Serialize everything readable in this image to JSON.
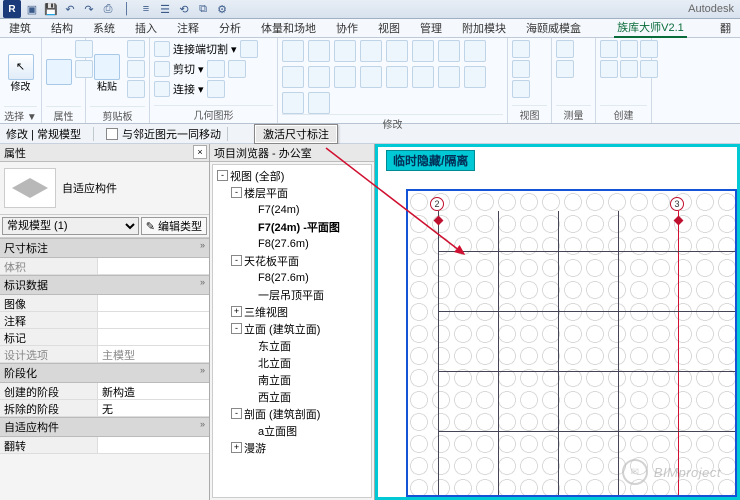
{
  "brand": "Autodesk",
  "logo": "R",
  "qat_icons": [
    "app-menu",
    "open",
    "save",
    "undo",
    "redo",
    "print",
    "separator",
    "measure",
    "select",
    "sync",
    "batch",
    "addin"
  ],
  "menubar": [
    "建筑",
    "结构",
    "系统",
    "插入",
    "注释",
    "分析",
    "体量和场地",
    "协作",
    "视图",
    "管理",
    "附加模块",
    "海颐威模盒",
    "族库大师V2.1",
    "翻"
  ],
  "menubar_active_index": 12,
  "ribbon": {
    "select": {
      "label": "选择 ▼",
      "btn": "修改"
    },
    "properties": {
      "label": "属性"
    },
    "clipboard": {
      "label": "剪贴板",
      "btn": "粘贴"
    },
    "geometry": {
      "label": "几何图形",
      "cope": "连接端切割",
      "cut": "剪切",
      "join": "连接"
    },
    "modify": {
      "label": "修改"
    },
    "view": {
      "label": "视图"
    },
    "measure": {
      "label": "测量"
    },
    "create": {
      "label": "创建"
    }
  },
  "options_bar": {
    "context": "修改 | 常规模型",
    "checkbox_label": "与邻近图元一同移动",
    "callout": "激活尺寸标注"
  },
  "properties": {
    "title": "属性",
    "type_name": "自适应构件",
    "type_selector": "常规模型 (1)",
    "edit_type": "编辑类型",
    "groups": {
      "dim": "尺寸标注",
      "id": "标识数据",
      "phase": "阶段化",
      "adapt": "自适应构件"
    },
    "rows": {
      "volume": {
        "k": "体积",
        "v": ""
      },
      "image": {
        "k": "图像",
        "v": ""
      },
      "comment": {
        "k": "注释",
        "v": ""
      },
      "mark": {
        "k": "标记",
        "v": ""
      },
      "design_option": {
        "k": "设计选项",
        "v": "主模型"
      },
      "phase_created": {
        "k": "创建的阶段",
        "v": "新构造"
      },
      "phase_demolished": {
        "k": "拆除的阶段",
        "v": "无"
      },
      "flip": {
        "k": "翻转",
        "v": ""
      }
    }
  },
  "browser": {
    "title": "项目浏览器 - 办公室",
    "nodes": [
      {
        "d": 0,
        "tw": "-",
        "label": "视图 (全部)"
      },
      {
        "d": 1,
        "tw": "-",
        "label": "楼层平面"
      },
      {
        "d": 2,
        "tw": "",
        "label": "F7(24m)"
      },
      {
        "d": 2,
        "tw": "",
        "label": "F7(24m) -平面图",
        "bold": true
      },
      {
        "d": 2,
        "tw": "",
        "label": "F8(27.6m)"
      },
      {
        "d": 1,
        "tw": "-",
        "label": "天花板平面"
      },
      {
        "d": 2,
        "tw": "",
        "label": "F8(27.6m)"
      },
      {
        "d": 2,
        "tw": "",
        "label": "一层吊顶平面"
      },
      {
        "d": 1,
        "tw": "+",
        "label": "三维视图"
      },
      {
        "d": 1,
        "tw": "-",
        "label": "立面 (建筑立面)"
      },
      {
        "d": 2,
        "tw": "",
        "label": "东立面"
      },
      {
        "d": 2,
        "tw": "",
        "label": "北立面"
      },
      {
        "d": 2,
        "tw": "",
        "label": "南立面"
      },
      {
        "d": 2,
        "tw": "",
        "label": "西立面"
      },
      {
        "d": 1,
        "tw": "-",
        "label": "剖面 (建筑剖面)"
      },
      {
        "d": 2,
        "tw": "",
        "label": "a立面图"
      },
      {
        "d": 1,
        "tw": "+",
        "label": "漫游"
      }
    ]
  },
  "canvas": {
    "hide_label": "临时隐藏/隔离",
    "grid_bubbles": [
      "2",
      "3"
    ],
    "watermark": "BIMproject"
  }
}
